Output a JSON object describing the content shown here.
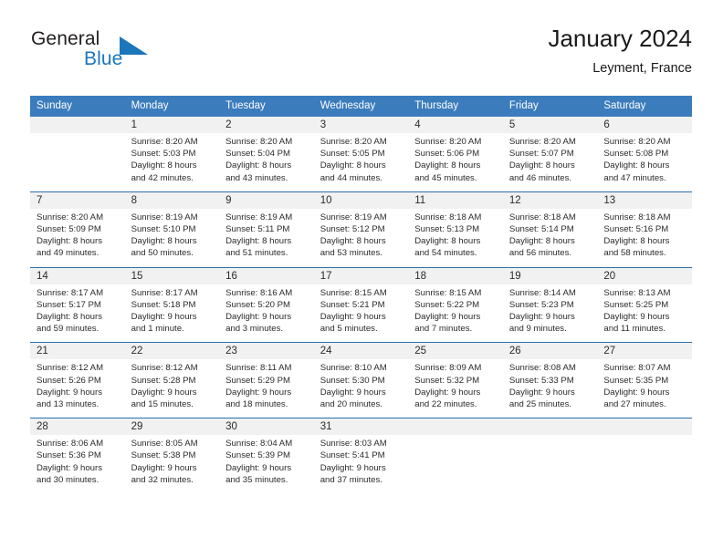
{
  "brand": {
    "name_part1": "General",
    "name_part2": "Blue",
    "logo_icon": "triangle-icon",
    "colors": {
      "blue": "#1b76bc",
      "dark": "#231f20"
    }
  },
  "header": {
    "title": "January 2024",
    "location": "Leyment, France"
  },
  "calendar": {
    "header_color": "#3b7cbd",
    "daynum_band_color": "#f1f1f1",
    "separator_color": "#2a6fae",
    "weekday_headers": [
      "Sunday",
      "Monday",
      "Tuesday",
      "Wednesday",
      "Thursday",
      "Friday",
      "Saturday"
    ],
    "weeks": [
      {
        "day_numbers": [
          "",
          "1",
          "2",
          "3",
          "4",
          "5",
          "6"
        ],
        "cells": [
          {
            "empty": true,
            "sunrise": "",
            "sunset": "",
            "daylight_line1": "",
            "daylight_line2": ""
          },
          {
            "empty": false,
            "sunrise": "Sunrise: 8:20 AM",
            "sunset": "Sunset: 5:03 PM",
            "daylight_line1": "Daylight: 8 hours",
            "daylight_line2": "and 42 minutes."
          },
          {
            "empty": false,
            "sunrise": "Sunrise: 8:20 AM",
            "sunset": "Sunset: 5:04 PM",
            "daylight_line1": "Daylight: 8 hours",
            "daylight_line2": "and 43 minutes."
          },
          {
            "empty": false,
            "sunrise": "Sunrise: 8:20 AM",
            "sunset": "Sunset: 5:05 PM",
            "daylight_line1": "Daylight: 8 hours",
            "daylight_line2": "and 44 minutes."
          },
          {
            "empty": false,
            "sunrise": "Sunrise: 8:20 AM",
            "sunset": "Sunset: 5:06 PM",
            "daylight_line1": "Daylight: 8 hours",
            "daylight_line2": "and 45 minutes."
          },
          {
            "empty": false,
            "sunrise": "Sunrise: 8:20 AM",
            "sunset": "Sunset: 5:07 PM",
            "daylight_line1": "Daylight: 8 hours",
            "daylight_line2": "and 46 minutes."
          },
          {
            "empty": false,
            "sunrise": "Sunrise: 8:20 AM",
            "sunset": "Sunset: 5:08 PM",
            "daylight_line1": "Daylight: 8 hours",
            "daylight_line2": "and 47 minutes."
          }
        ]
      },
      {
        "day_numbers": [
          "7",
          "8",
          "9",
          "10",
          "11",
          "12",
          "13"
        ],
        "cells": [
          {
            "empty": false,
            "sunrise": "Sunrise: 8:20 AM",
            "sunset": "Sunset: 5:09 PM",
            "daylight_line1": "Daylight: 8 hours",
            "daylight_line2": "and 49 minutes."
          },
          {
            "empty": false,
            "sunrise": "Sunrise: 8:19 AM",
            "sunset": "Sunset: 5:10 PM",
            "daylight_line1": "Daylight: 8 hours",
            "daylight_line2": "and 50 minutes."
          },
          {
            "empty": false,
            "sunrise": "Sunrise: 8:19 AM",
            "sunset": "Sunset: 5:11 PM",
            "daylight_line1": "Daylight: 8 hours",
            "daylight_line2": "and 51 minutes."
          },
          {
            "empty": false,
            "sunrise": "Sunrise: 8:19 AM",
            "sunset": "Sunset: 5:12 PM",
            "daylight_line1": "Daylight: 8 hours",
            "daylight_line2": "and 53 minutes."
          },
          {
            "empty": false,
            "sunrise": "Sunrise: 8:18 AM",
            "sunset": "Sunset: 5:13 PM",
            "daylight_line1": "Daylight: 8 hours",
            "daylight_line2": "and 54 minutes."
          },
          {
            "empty": false,
            "sunrise": "Sunrise: 8:18 AM",
            "sunset": "Sunset: 5:14 PM",
            "daylight_line1": "Daylight: 8 hours",
            "daylight_line2": "and 56 minutes."
          },
          {
            "empty": false,
            "sunrise": "Sunrise: 8:18 AM",
            "sunset": "Sunset: 5:16 PM",
            "daylight_line1": "Daylight: 8 hours",
            "daylight_line2": "and 58 minutes."
          }
        ]
      },
      {
        "day_numbers": [
          "14",
          "15",
          "16",
          "17",
          "18",
          "19",
          "20"
        ],
        "cells": [
          {
            "empty": false,
            "sunrise": "Sunrise: 8:17 AM",
            "sunset": "Sunset: 5:17 PM",
            "daylight_line1": "Daylight: 8 hours",
            "daylight_line2": "and 59 minutes."
          },
          {
            "empty": false,
            "sunrise": "Sunrise: 8:17 AM",
            "sunset": "Sunset: 5:18 PM",
            "daylight_line1": "Daylight: 9 hours",
            "daylight_line2": "and 1 minute."
          },
          {
            "empty": false,
            "sunrise": "Sunrise: 8:16 AM",
            "sunset": "Sunset: 5:20 PM",
            "daylight_line1": "Daylight: 9 hours",
            "daylight_line2": "and 3 minutes."
          },
          {
            "empty": false,
            "sunrise": "Sunrise: 8:15 AM",
            "sunset": "Sunset: 5:21 PM",
            "daylight_line1": "Daylight: 9 hours",
            "daylight_line2": "and 5 minutes."
          },
          {
            "empty": false,
            "sunrise": "Sunrise: 8:15 AM",
            "sunset": "Sunset: 5:22 PM",
            "daylight_line1": "Daylight: 9 hours",
            "daylight_line2": "and 7 minutes."
          },
          {
            "empty": false,
            "sunrise": "Sunrise: 8:14 AM",
            "sunset": "Sunset: 5:23 PM",
            "daylight_line1": "Daylight: 9 hours",
            "daylight_line2": "and 9 minutes."
          },
          {
            "empty": false,
            "sunrise": "Sunrise: 8:13 AM",
            "sunset": "Sunset: 5:25 PM",
            "daylight_line1": "Daylight: 9 hours",
            "daylight_line2": "and 11 minutes."
          }
        ]
      },
      {
        "day_numbers": [
          "21",
          "22",
          "23",
          "24",
          "25",
          "26",
          "27"
        ],
        "cells": [
          {
            "empty": false,
            "sunrise": "Sunrise: 8:12 AM",
            "sunset": "Sunset: 5:26 PM",
            "daylight_line1": "Daylight: 9 hours",
            "daylight_line2": "and 13 minutes."
          },
          {
            "empty": false,
            "sunrise": "Sunrise: 8:12 AM",
            "sunset": "Sunset: 5:28 PM",
            "daylight_line1": "Daylight: 9 hours",
            "daylight_line2": "and 15 minutes."
          },
          {
            "empty": false,
            "sunrise": "Sunrise: 8:11 AM",
            "sunset": "Sunset: 5:29 PM",
            "daylight_line1": "Daylight: 9 hours",
            "daylight_line2": "and 18 minutes."
          },
          {
            "empty": false,
            "sunrise": "Sunrise: 8:10 AM",
            "sunset": "Sunset: 5:30 PM",
            "daylight_line1": "Daylight: 9 hours",
            "daylight_line2": "and 20 minutes."
          },
          {
            "empty": false,
            "sunrise": "Sunrise: 8:09 AM",
            "sunset": "Sunset: 5:32 PM",
            "daylight_line1": "Daylight: 9 hours",
            "daylight_line2": "and 22 minutes."
          },
          {
            "empty": false,
            "sunrise": "Sunrise: 8:08 AM",
            "sunset": "Sunset: 5:33 PM",
            "daylight_line1": "Daylight: 9 hours",
            "daylight_line2": "and 25 minutes."
          },
          {
            "empty": false,
            "sunrise": "Sunrise: 8:07 AM",
            "sunset": "Sunset: 5:35 PM",
            "daylight_line1": "Daylight: 9 hours",
            "daylight_line2": "and 27 minutes."
          }
        ]
      },
      {
        "day_numbers": [
          "28",
          "29",
          "30",
          "31",
          "",
          "",
          ""
        ],
        "cells": [
          {
            "empty": false,
            "sunrise": "Sunrise: 8:06 AM",
            "sunset": "Sunset: 5:36 PM",
            "daylight_line1": "Daylight: 9 hours",
            "daylight_line2": "and 30 minutes."
          },
          {
            "empty": false,
            "sunrise": "Sunrise: 8:05 AM",
            "sunset": "Sunset: 5:38 PM",
            "daylight_line1": "Daylight: 9 hours",
            "daylight_line2": "and 32 minutes."
          },
          {
            "empty": false,
            "sunrise": "Sunrise: 8:04 AM",
            "sunset": "Sunset: 5:39 PM",
            "daylight_line1": "Daylight: 9 hours",
            "daylight_line2": "and 35 minutes."
          },
          {
            "empty": false,
            "sunrise": "Sunrise: 8:03 AM",
            "sunset": "Sunset: 5:41 PM",
            "daylight_line1": "Daylight: 9 hours",
            "daylight_line2": "and 37 minutes."
          },
          {
            "empty": true,
            "sunrise": "",
            "sunset": "",
            "daylight_line1": "",
            "daylight_line2": ""
          },
          {
            "empty": true,
            "sunrise": "",
            "sunset": "",
            "daylight_line1": "",
            "daylight_line2": ""
          },
          {
            "empty": true,
            "sunrise": "",
            "sunset": "",
            "daylight_line1": "",
            "daylight_line2": ""
          }
        ]
      }
    ]
  }
}
